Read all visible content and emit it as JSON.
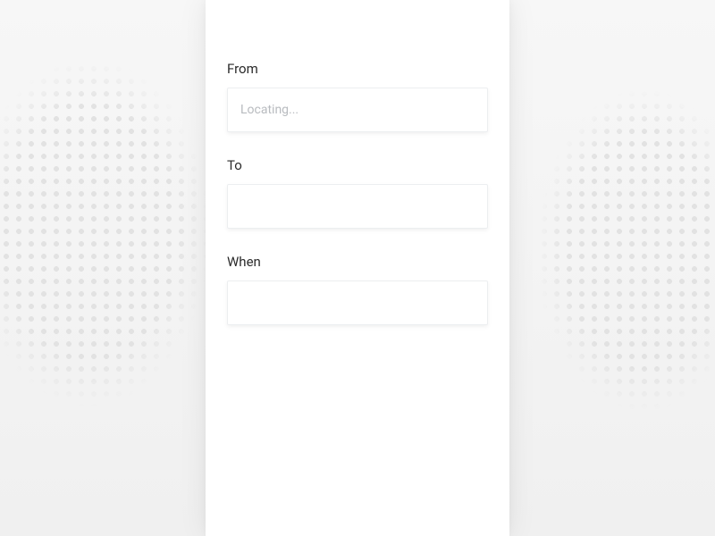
{
  "form": {
    "from": {
      "label": "From",
      "placeholder": "Locating...",
      "value": ""
    },
    "to": {
      "label": "To",
      "placeholder": "",
      "value": ""
    },
    "when": {
      "label": "When",
      "placeholder": "",
      "value": ""
    }
  }
}
